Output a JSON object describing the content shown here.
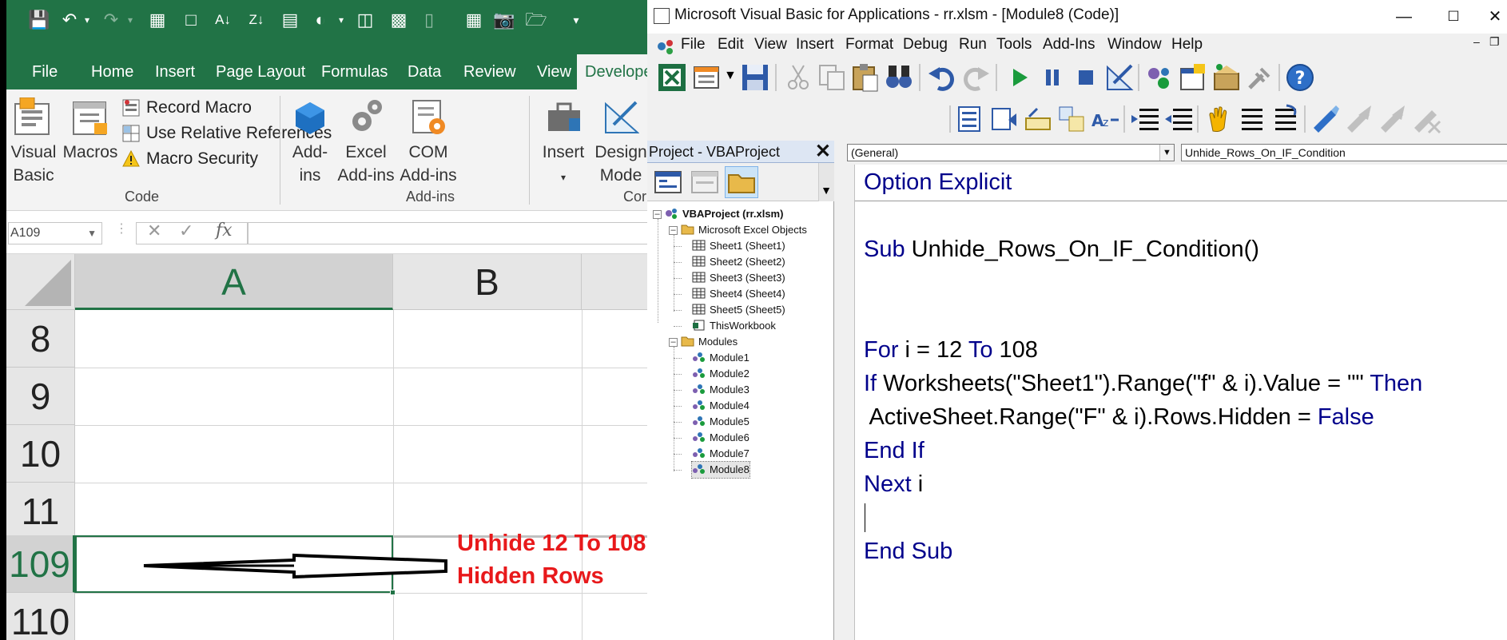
{
  "excel": {
    "tabs": [
      "File",
      "Home",
      "Insert",
      "Page Layout",
      "Formulas",
      "Data",
      "Review",
      "View",
      "Develope"
    ],
    "ribbon": {
      "visual_basic_l1": "Visual",
      "visual_basic_l2": "Basic",
      "macros": "Macros",
      "record_macro": "Record Macro",
      "relative_refs": "Use Relative References",
      "macro_security": "Macro Security",
      "code_group": "Code",
      "addins_l1": "Add-",
      "addins_l2": "ins",
      "excel_addins_l1": "Excel",
      "excel_addins_l2": "Add-ins",
      "com_addins_l1": "COM",
      "com_addins_l2": "Add-ins",
      "addins_group": "Add-ins",
      "insert": "Insert",
      "design_l1": "Design",
      "design_l2": "Mode",
      "controls_group": "Cor"
    },
    "namebox": "A109",
    "fx": "fx",
    "columns": [
      "A",
      "B"
    ],
    "rows": [
      "8",
      "9",
      "10",
      "11",
      "109",
      "110"
    ],
    "selected_cell": "A109",
    "annotation_l1": "Unhide 12 To 108",
    "annotation_l2": "Hidden Rows"
  },
  "vbe": {
    "title": "Microsoft Visual Basic for Applications - rr.xlsm - [Module8 (Code)]",
    "menu": [
      "File",
      "Edit",
      "View",
      "Insert",
      "Format",
      "Debug",
      "Run",
      "Tools",
      "Add-Ins",
      "Window",
      "Help"
    ],
    "project_header": "Project - VBAProject",
    "tree": {
      "root": "VBAProject (rr.xlsm)",
      "excel_objects": "Microsoft Excel Objects",
      "sheets": [
        "Sheet1 (Sheet1)",
        "Sheet2 (Sheet2)",
        "Sheet3 (Sheet3)",
        "Sheet4 (Sheet4)",
        "Sheet5 (Sheet5)"
      ],
      "workbook": "ThisWorkbook",
      "modules_folder": "Modules",
      "modules": [
        "Module1",
        "Module2",
        "Module3",
        "Module4",
        "Module5",
        "Module6",
        "Module7",
        "Module8"
      ]
    },
    "combo_object": "(General)",
    "combo_proc": "Unhide_Rows_On_IF_Condition",
    "code": {
      "l1_kw": "Option Explicit",
      "l2_kw": "Sub",
      "l2_rest": " Unhide_Rows_On_IF_Condition()",
      "l3_kw1": "For",
      "l3_mid": " i = 12 ",
      "l3_kw2": "To",
      "l3_end": " 108",
      "l4_kw1": "If",
      "l4_mid": " Worksheets(\"Sheet1\").Range(\"f\" & i).Value = \"\" ",
      "l4_kw2": "Then",
      "l5_mid": " ActiveSheet.Range(\"F\" & i).Rows.Hidden = ",
      "l5_kw": "False",
      "l6_kw": "End If",
      "l7_kw": "Next",
      "l7_rest": " i",
      "l8_kw": "End Sub"
    }
  }
}
